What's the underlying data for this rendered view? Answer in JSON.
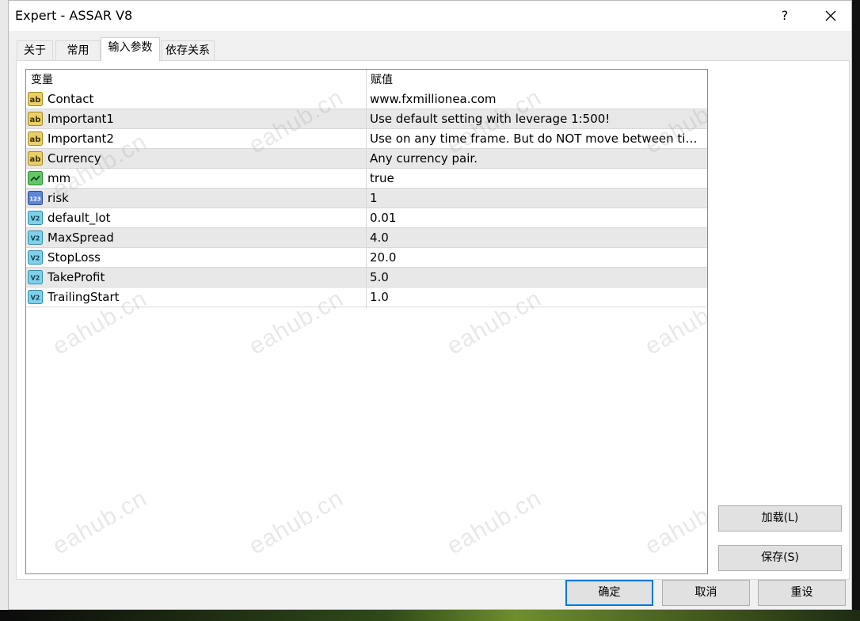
{
  "window": {
    "title": "Expert - ASSAR V8",
    "help_label": "?"
  },
  "tabs": [
    {
      "label": "关于"
    },
    {
      "label": "常用"
    },
    {
      "label": "输入参数"
    },
    {
      "label": "依存关系"
    }
  ],
  "grid": {
    "headers": {
      "variable": "变量",
      "value": "赋值"
    },
    "rows": [
      {
        "name": "Contact",
        "value": "www.fxmillionea.com",
        "icon": "string-icon"
      },
      {
        "name": "Important1",
        "value": "Use default setting with leverage 1:500!",
        "icon": "string-icon"
      },
      {
        "name": "Important2",
        "value": "Use on any time frame. But do NOT move between time …",
        "icon": "string-icon"
      },
      {
        "name": "Currency",
        "value": "Any currency pair.",
        "icon": "string-icon"
      },
      {
        "name": "mm",
        "value": "true",
        "icon": "bool-icon"
      },
      {
        "name": "risk",
        "value": "1",
        "icon": "integer-icon"
      },
      {
        "name": "default_lot",
        "value": "0.01",
        "icon": "double-icon"
      },
      {
        "name": "MaxSpread",
        "value": "4.0",
        "icon": "double-icon"
      },
      {
        "name": "StopLoss",
        "value": "20.0",
        "icon": "double-icon"
      },
      {
        "name": "TakeProfit",
        "value": "5.0",
        "icon": "double-icon"
      },
      {
        "name": "TrailingStart",
        "value": "1.0",
        "icon": "double-icon"
      }
    ]
  },
  "side_buttons": {
    "load": "加载(L)",
    "save": "保存(S)"
  },
  "footer_buttons": {
    "ok": "确定",
    "cancel": "取消",
    "reset": "重设"
  },
  "watermark": "eahub.cn",
  "colors": {
    "accent": "#0078d7",
    "alt_row": "#e8e8e8"
  }
}
